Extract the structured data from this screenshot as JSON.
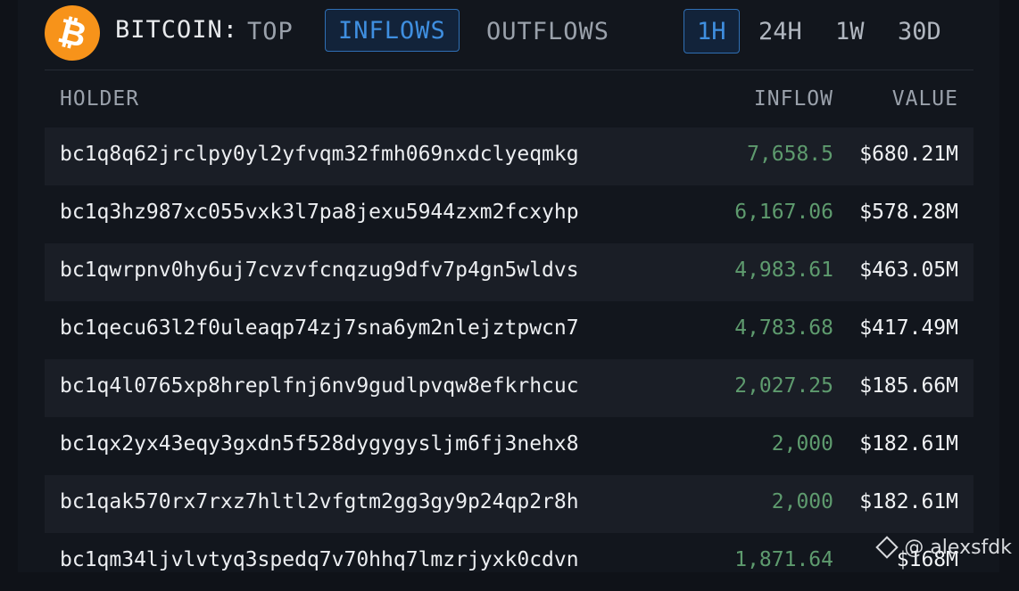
{
  "header": {
    "coin_icon": "bitcoin-icon",
    "coin_label": "BITCOIN:",
    "tabs": [
      {
        "label": "TOP",
        "active": false
      },
      {
        "label": "INFLOWS",
        "active": true
      },
      {
        "label": "OUTFLOWS",
        "active": false
      }
    ],
    "time_ranges": [
      {
        "label": "1H",
        "active": true
      },
      {
        "label": "24H",
        "active": false
      },
      {
        "label": "1W",
        "active": false
      },
      {
        "label": "30D",
        "active": false
      }
    ]
  },
  "table": {
    "columns": [
      "HOLDER",
      "INFLOW",
      "VALUE"
    ],
    "rows": [
      {
        "holder": "bc1q8q62jrclpy0yl2yfvqm32fmh069nxdclyeqmkg",
        "inflow": "7,658.5",
        "value": "$680.21M"
      },
      {
        "holder": "bc1q3hz987xc055vxk3l7pa8jexu5944zxm2fcxyhp",
        "inflow": "6,167.06",
        "value": "$578.28M"
      },
      {
        "holder": "bc1qwrpnv0hy6uj7cvzvfcnqzug9dfv7p4gn5wldvs",
        "inflow": "4,983.61",
        "value": "$463.05M"
      },
      {
        "holder": "bc1qecu63l2f0uleaqp74zj7sna6ym2nlejztpwcn7",
        "inflow": "4,783.68",
        "value": "$417.49M"
      },
      {
        "holder": "bc1q4l0765xp8hreplfnj6nv9gudlpvqw8efkrhcuc",
        "inflow": "2,027.25",
        "value": "$185.66M"
      },
      {
        "holder": "bc1qx2yx43eqy3gxdn5f528dygygysljm6fj3nehx8",
        "inflow": "2,000",
        "value": "$182.61M"
      },
      {
        "holder": "bc1qak570rx7rxz7hltl2vfgtm2gg3gy9p24qp2r8h",
        "inflow": "2,000",
        "value": "$182.61M"
      },
      {
        "holder": "bc1qm34ljvlvtyq3spedq7v70hhq7lmzrjyxk0cdvn",
        "inflow": "1,871.64",
        "value": "$168M"
      }
    ]
  },
  "watermark": {
    "icon": "binance-icon",
    "text": "@ alexsfdk"
  },
  "colors": {
    "accent": "#3f8fe0",
    "inflow_green": "#5e9b6e",
    "bitcoin_orange": "#f7931a"
  }
}
